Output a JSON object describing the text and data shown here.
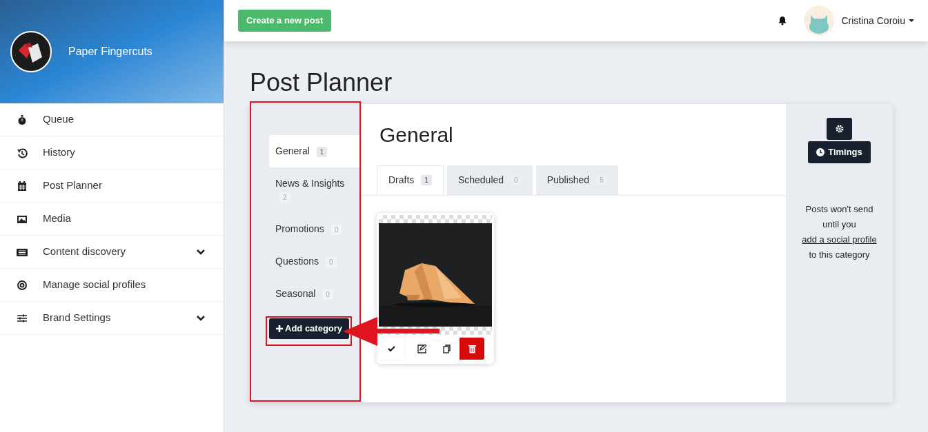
{
  "brand": {
    "name": "Paper Fingercuts"
  },
  "nav": [
    {
      "label": "Queue",
      "expandable": false
    },
    {
      "label": "History",
      "expandable": false
    },
    {
      "label": "Post Planner",
      "expandable": false
    },
    {
      "label": "Media",
      "expandable": false
    },
    {
      "label": "Content discovery",
      "expandable": true
    },
    {
      "label": "Manage social profiles",
      "expandable": false
    },
    {
      "label": "Brand Settings",
      "expandable": true
    }
  ],
  "topbar": {
    "create_button": "Create a new post",
    "user": "Cristina Coroiu"
  },
  "page_title": "Post Planner",
  "categories": [
    {
      "label": "General",
      "count": "1",
      "selected": true
    },
    {
      "label": "News & Insights",
      "count": "2",
      "selected": false
    },
    {
      "label": "Promotions",
      "count": "0",
      "selected": false
    },
    {
      "label": "Questions",
      "count": "0",
      "selected": false
    },
    {
      "label": "Seasonal",
      "count": "0",
      "selected": false
    }
  ],
  "add_category": "Add category",
  "category_title": "General",
  "tabs": [
    {
      "label": "Drafts",
      "count": "1",
      "selected": true
    },
    {
      "label": "Scheduled",
      "count": "0",
      "selected": false
    },
    {
      "label": "Published",
      "count": "5",
      "selected": false
    }
  ],
  "side_panel": {
    "timings_button": "Timings",
    "notice_before": "Posts won't send until you",
    "notice_link": "add a social profile",
    "notice_after": "to this category"
  }
}
